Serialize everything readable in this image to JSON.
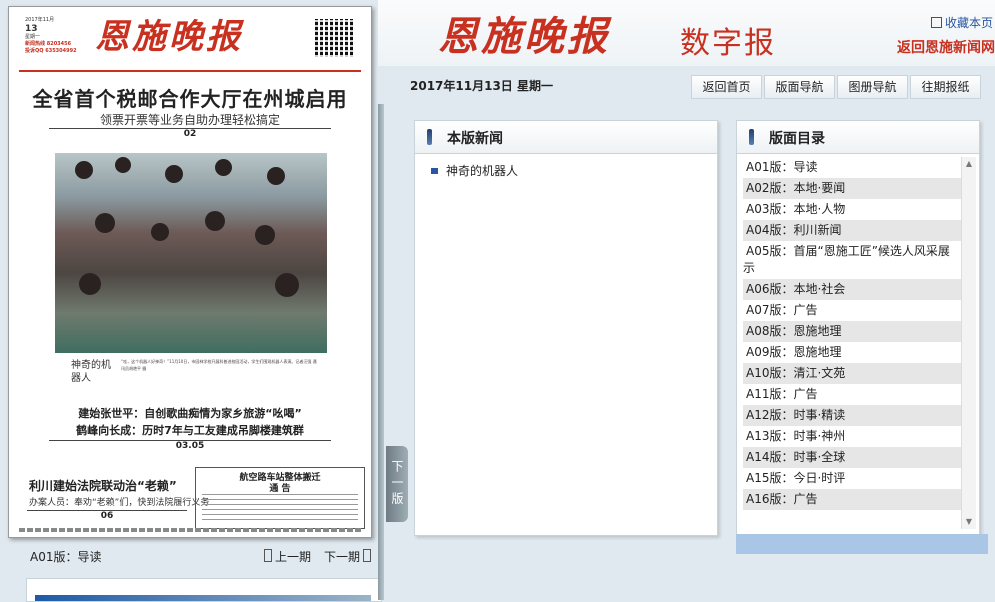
{
  "header": {
    "brand": "恩施晚报",
    "brand_suffix": "数字报",
    "favorite": "收藏本页",
    "back_news": "返回恩施新闻网"
  },
  "datebar": {
    "date": "2017年11月13日 星期一",
    "buttons": [
      "返回首页",
      "版面导航",
      "图册导航",
      "往期报纸"
    ]
  },
  "paper": {
    "logo": "恩施晚报",
    "info_lines": [
      "2017年11月",
      "13",
      "星期一",
      "新闻热线 8203456",
      "投诉QQ 635304992"
    ],
    "headline": "全省首个税邮合作大厅在州城启用",
    "subheadline": "领票开票等业务自助办理轻松搞定",
    "page_ref_1": "02",
    "photo_caption_title": "神奇的机器人",
    "photo_caption_text": "“哇，这个机器人好神奇！”11月10日，市园林学校开展科普进校园活动，学生们围观机器人表演。记者汪强 通讯员胡艳平 摄",
    "headline2": "建始张世平：自创歌曲痴情为家乡旅游“吆喝”",
    "headline3": "鹤峰向长成：历时7年与工友建成吊脚楼建筑群",
    "page_ref_2": "03.05",
    "headline4": "利川建始法院联动治“老赖”",
    "headline4_sub": "办案人员：奉劝“老赖”们，快到法院履行义务",
    "page_ref_3": "06",
    "notice_title": "航空路车站整体搬迁",
    "notice_subtitle": "通  告",
    "current_page": "A01版：导读",
    "prev": "上一期",
    "next": "下一期",
    "next_tab": "下一版"
  },
  "news_panel": {
    "title": "本版新闻",
    "items": [
      "神奇的机器人"
    ]
  },
  "toc_panel": {
    "title": "版面目录",
    "items": [
      "A01版：导读",
      "A02版：本地·要闻",
      "A03版：本地·人物",
      "A04版：利川新闻",
      "A05版：首届“恩施工匠”候选人风采展示",
      "A06版：本地·社会",
      "A07版：广告",
      "A08版：恩施地理",
      "A09版：恩施地理",
      "A10版：清江·文苑",
      "A11版：广告",
      "A12版：时事·精读",
      "A13版：时事·神州",
      "A14版：时事·全球",
      "A15版：今日·时评",
      "A16版：广告"
    ]
  }
}
